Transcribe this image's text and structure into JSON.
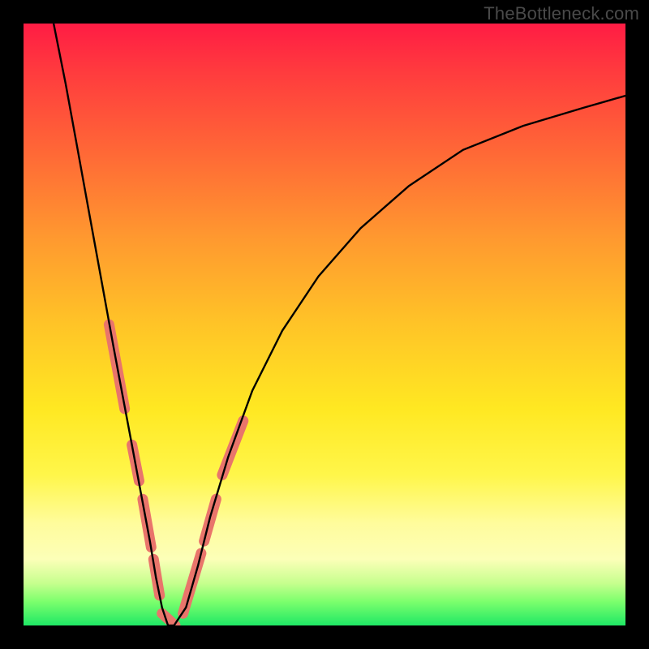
{
  "watermark": {
    "text": "TheBottleneck.com"
  },
  "chart_data": {
    "type": "line",
    "title": "",
    "xlabel": "",
    "ylabel": "",
    "xlim": [
      0,
      100
    ],
    "ylim": [
      0,
      100
    ],
    "series": [
      {
        "name": "bottleneck-curve",
        "x": [
          5,
          7,
          9,
          11,
          13,
          15,
          16.5,
          18,
          19.5,
          21,
          22,
          23,
          24,
          25,
          27,
          29,
          31,
          34,
          38,
          43,
          49,
          56,
          64,
          73,
          83,
          93,
          100
        ],
        "values": [
          100,
          90,
          79,
          68,
          57,
          46,
          38,
          30,
          22,
          14,
          8,
          3,
          0,
          0,
          3,
          10,
          18,
          28,
          39,
          49,
          58,
          66,
          73,
          79,
          83,
          86,
          88
        ]
      }
    ],
    "markers": {
      "name": "highlighted-segments",
      "comment": "Salmon-colored thick strokes overlaid on parts of the curve near the valley",
      "segments": [
        {
          "x": [
            14.2,
            16.8
          ],
          "values": [
            50,
            36
          ]
        },
        {
          "x": [
            18.0,
            19.2
          ],
          "values": [
            30,
            24
          ]
        },
        {
          "x": [
            19.8,
            21.2
          ],
          "values": [
            21,
            13
          ]
        },
        {
          "x": [
            21.6,
            22.6
          ],
          "values": [
            11,
            5
          ]
        },
        {
          "x": [
            23.0,
            25.2
          ],
          "values": [
            2,
            0
          ]
        },
        {
          "x": [
            26.5,
            29.5
          ],
          "values": [
            2,
            12
          ]
        },
        {
          "x": [
            30.0,
            32.0
          ],
          "values": [
            14,
            21
          ]
        },
        {
          "x": [
            33.0,
            36.5
          ],
          "values": [
            25,
            34
          ]
        }
      ],
      "color": "#e9756b"
    },
    "gradient_bands": {
      "comment": "Background color ramp from top (red) to bottom (green, at y=0)",
      "stops": [
        {
          "y": 100,
          "color": "#ff1c44"
        },
        {
          "y": 50,
          "color": "#ffc427"
        },
        {
          "y": 15,
          "color": "#fffc9c"
        },
        {
          "y": 0,
          "color": "#1fe865"
        }
      ]
    }
  }
}
